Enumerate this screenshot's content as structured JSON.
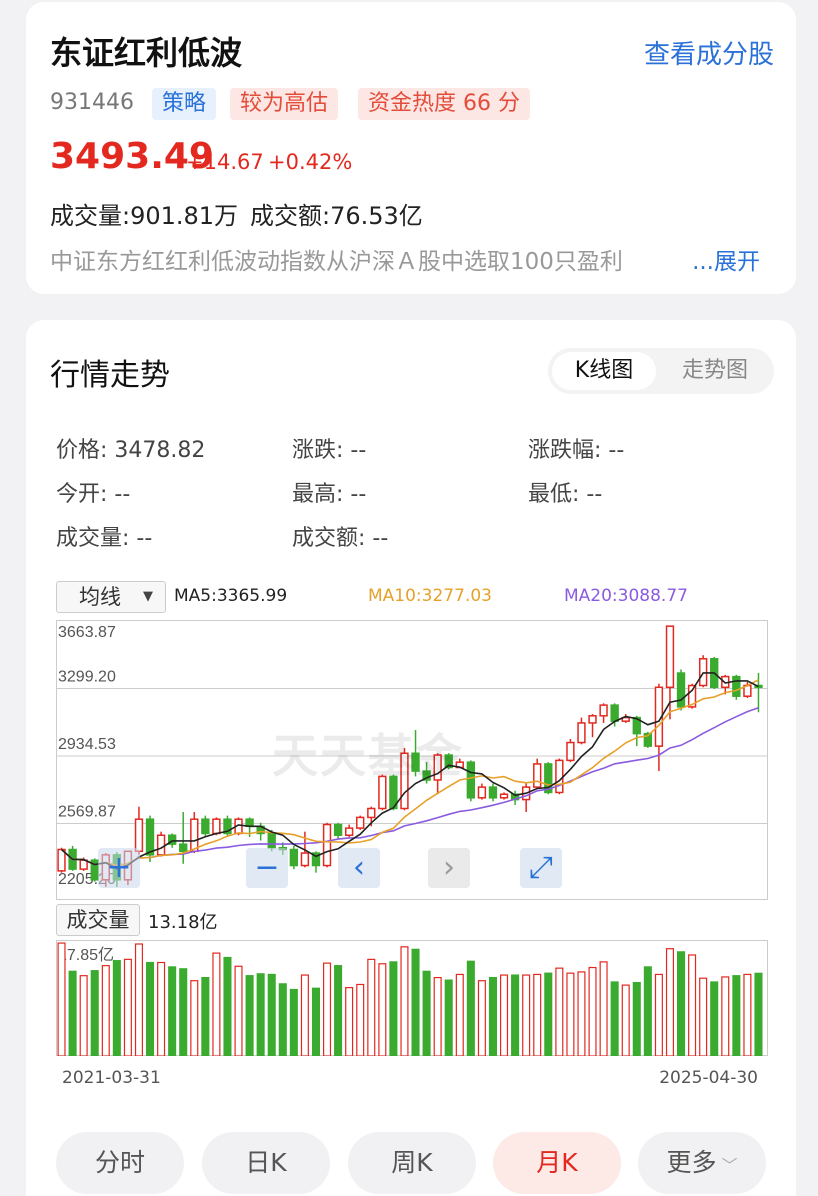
{
  "header": {
    "title": "东证红利低波",
    "link": "查看成分股",
    "code": "931446",
    "tags": [
      "策略",
      "较为高估",
      "资金热度 66 分"
    ],
    "price": "3493.49",
    "change": "+14.67",
    "change_pct": "+0.42%",
    "volume": "成交量:901.81万",
    "amount": "成交额:76.53亿",
    "description": "中证东方红红利低波动指数从沪深Ａ股中选取100只盈利",
    "expand": "...展开"
  },
  "market": {
    "title": "行情走势",
    "tabs": [
      "K线图",
      "走势图"
    ],
    "info": {
      "price": "价格: 3478.82",
      "change": "涨跌: --",
      "change_pct": "涨跌幅: --",
      "open": "今开: --",
      "high": "最高: --",
      "low": "最低: --",
      "volume": "成交量: --",
      "amount": "成交额: --"
    },
    "ma_select": "均线",
    "ma5": "MA5:3365.99",
    "ma10": "MA10:3277.03",
    "ma20": "MA20:3088.77",
    "watermark": "天天基金",
    "zoom_buttons": [
      "+",
      "−",
      "‹",
      "›",
      "⤢"
    ],
    "volume_label": "成交量",
    "volume_value": "13.18亿",
    "volume_max": "17.85亿",
    "date_start": "2021-03-31",
    "date_end": "2025-04-30"
  },
  "periods": [
    "分时",
    "日K",
    "周K",
    "月K",
    "更多"
  ],
  "colors": {
    "up": "#e3281f",
    "down": "#3aab2e",
    "ma5": "#222222",
    "ma10": "#e7a12a",
    "ma20": "#8a5be0",
    "accent": "#2a72d8"
  },
  "chart_data": {
    "type": "candlestick",
    "y_ticks": [
      "3663.87",
      "3299.20",
      "2934.53",
      "2569.87",
      "2205.20"
    ],
    "ylim": [
      2205.2,
      3663.87
    ],
    "volume_ylim": [
      0,
      17.85
    ],
    "candles": [
      {
        "o": 2290,
        "c": 2410,
        "h": 2420,
        "l": 2280,
        "v": 18.0
      },
      {
        "o": 2410,
        "c": 2300,
        "h": 2430,
        "l": 2290,
        "v": 13.5
      },
      {
        "o": 2300,
        "c": 2350,
        "h": 2365,
        "l": 2290,
        "v": 12.8
      },
      {
        "o": 2350,
        "c": 2240,
        "h": 2360,
        "l": 2230,
        "v": 13.6
      },
      {
        "o": 2240,
        "c": 2380,
        "h": 2390,
        "l": 2200,
        "v": 14.4
      },
      {
        "o": 2380,
        "c": 2240,
        "h": 2395,
        "l": 2200,
        "v": 15.2
      },
      {
        "o": 2240,
        "c": 2400,
        "h": 2400,
        "l": 2210,
        "v": 15.4
      },
      {
        "o": 2400,
        "c": 2580,
        "h": 2650,
        "l": 2380,
        "v": 17.85
      },
      {
        "o": 2580,
        "c": 2380,
        "h": 2600,
        "l": 2340,
        "v": 14.9
      },
      {
        "o": 2380,
        "c": 2490,
        "h": 2510,
        "l": 2370,
        "v": 14.9
      },
      {
        "o": 2490,
        "c": 2440,
        "h": 2500,
        "l": 2420,
        "v": 14.2
      },
      {
        "o": 2440,
        "c": 2400,
        "h": 2620,
        "l": 2330,
        "v": 13.9
      },
      {
        "o": 2400,
        "c": 2580,
        "h": 2620,
        "l": 2390,
        "v": 12.0
      },
      {
        "o": 2580,
        "c": 2500,
        "h": 2600,
        "l": 2480,
        "v": 12.5
      },
      {
        "o": 2500,
        "c": 2580,
        "h": 2590,
        "l": 2490,
        "v": 16.4
      },
      {
        "o": 2580,
        "c": 2500,
        "h": 2600,
        "l": 2480,
        "v": 15.7
      },
      {
        "o": 2500,
        "c": 2580,
        "h": 2590,
        "l": 2490,
        "v": 14.3
      },
      {
        "o": 2580,
        "c": 2540,
        "h": 2590,
        "l": 2480,
        "v": 12.8
      },
      {
        "o": 2540,
        "c": 2500,
        "h": 2560,
        "l": 2460,
        "v": 13.1
      },
      {
        "o": 2500,
        "c": 2420,
        "h": 2520,
        "l": 2400,
        "v": 13.0
      },
      {
        "o": 2420,
        "c": 2410,
        "h": 2450,
        "l": 2380,
        "v": 11.5
      },
      {
        "o": 2410,
        "c": 2320,
        "h": 2430,
        "l": 2300,
        "v": 10.6
      },
      {
        "o": 2320,
        "c": 2390,
        "h": 2510,
        "l": 2310,
        "v": 12.9
      },
      {
        "o": 2390,
        "c": 2320,
        "h": 2400,
        "l": 2280,
        "v": 10.8
      },
      {
        "o": 2320,
        "c": 2550,
        "h": 2560,
        "l": 2310,
        "v": 14.8
      },
      {
        "o": 2550,
        "c": 2490,
        "h": 2560,
        "l": 2470,
        "v": 14.4
      },
      {
        "o": 2490,
        "c": 2530,
        "h": 2550,
        "l": 2480,
        "v": 10.9
      },
      {
        "o": 2530,
        "c": 2590,
        "h": 2600,
        "l": 2520,
        "v": 11.4
      },
      {
        "o": 2590,
        "c": 2640,
        "h": 2650,
        "l": 2540,
        "v": 15.4
      },
      {
        "o": 2640,
        "c": 2820,
        "h": 2830,
        "l": 2630,
        "v": 14.7
      },
      {
        "o": 2820,
        "c": 2640,
        "h": 2830,
        "l": 2630,
        "v": 15.0
      },
      {
        "o": 2640,
        "c": 2950,
        "h": 2980,
        "l": 2630,
        "v": 17.4
      },
      {
        "o": 2950,
        "c": 2850,
        "h": 3080,
        "l": 2820,
        "v": 17.0
      },
      {
        "o": 2850,
        "c": 2800,
        "h": 2900,
        "l": 2780,
        "v": 13.5
      },
      {
        "o": 2800,
        "c": 2940,
        "h": 2950,
        "l": 2720,
        "v": 12.5
      },
      {
        "o": 2940,
        "c": 2870,
        "h": 2950,
        "l": 2860,
        "v": 12.1
      },
      {
        "o": 2870,
        "c": 2900,
        "h": 2920,
        "l": 2880,
        "v": 13.0
      },
      {
        "o": 2900,
        "c": 2700,
        "h": 2910,
        "l": 2680,
        "v": 15.1
      },
      {
        "o": 2700,
        "c": 2760,
        "h": 2780,
        "l": 2690,
        "v": 12.0
      },
      {
        "o": 2760,
        "c": 2700,
        "h": 2780,
        "l": 2680,
        "v": 12.5
      },
      {
        "o": 2700,
        "c": 2720,
        "h": 2730,
        "l": 2690,
        "v": 12.9
      },
      {
        "o": 2720,
        "c": 2690,
        "h": 2740,
        "l": 2660,
        "v": 12.9
      },
      {
        "o": 2690,
        "c": 2760,
        "h": 2780,
        "l": 2620,
        "v": 12.9
      },
      {
        "o": 2760,
        "c": 2890,
        "h": 2920,
        "l": 2750,
        "v": 13.0
      },
      {
        "o": 2890,
        "c": 2730,
        "h": 2900,
        "l": 2720,
        "v": 13.2
      },
      {
        "o": 2730,
        "c": 2910,
        "h": 2920,
        "l": 2720,
        "v": 14.0
      },
      {
        "o": 2910,
        "c": 3010,
        "h": 3030,
        "l": 2900,
        "v": 13.2
      },
      {
        "o": 3010,
        "c": 3120,
        "h": 3150,
        "l": 3000,
        "v": 13.4
      },
      {
        "o": 3120,
        "c": 3160,
        "h": 3170,
        "l": 3040,
        "v": 14.1
      },
      {
        "o": 3160,
        "c": 3220,
        "h": 3230,
        "l": 3120,
        "v": 15.0
      },
      {
        "o": 3220,
        "c": 3130,
        "h": 3230,
        "l": 3100,
        "v": 11.8
      },
      {
        "o": 3130,
        "c": 3150,
        "h": 3170,
        "l": 3120,
        "v": 11.3
      },
      {
        "o": 3150,
        "c": 3060,
        "h": 3160,
        "l": 2990,
        "v": 11.7
      },
      {
        "o": 3060,
        "c": 2990,
        "h": 3070,
        "l": 2980,
        "v": 14.2
      },
      {
        "o": 2990,
        "c": 3320,
        "h": 3340,
        "l": 2850,
        "v": 13.0
      },
      {
        "o": 3320,
        "c": 3663,
        "h": 3663,
        "l": 3140,
        "v": 17.1
      },
      {
        "o": 3400,
        "c": 3210,
        "h": 3420,
        "l": 3190,
        "v": 16.6
      },
      {
        "o": 3210,
        "c": 3330,
        "h": 3340,
        "l": 3200,
        "v": 16.1
      },
      {
        "o": 3330,
        "c": 3480,
        "h": 3500,
        "l": 3320,
        "v": 12.4
      },
      {
        "o": 3480,
        "c": 3320,
        "h": 3490,
        "l": 3310,
        "v": 11.8
      },
      {
        "o": 3320,
        "c": 3380,
        "h": 3390,
        "l": 3280,
        "v": 12.6
      },
      {
        "o": 3380,
        "c": 3270,
        "h": 3390,
        "l": 3250,
        "v": 12.8
      },
      {
        "o": 3270,
        "c": 3330,
        "h": 3350,
        "l": 3260,
        "v": 13.0
      },
      {
        "o": 3330,
        "c": 3320,
        "h": 3400,
        "l": 3180,
        "v": 13.18
      }
    ]
  }
}
